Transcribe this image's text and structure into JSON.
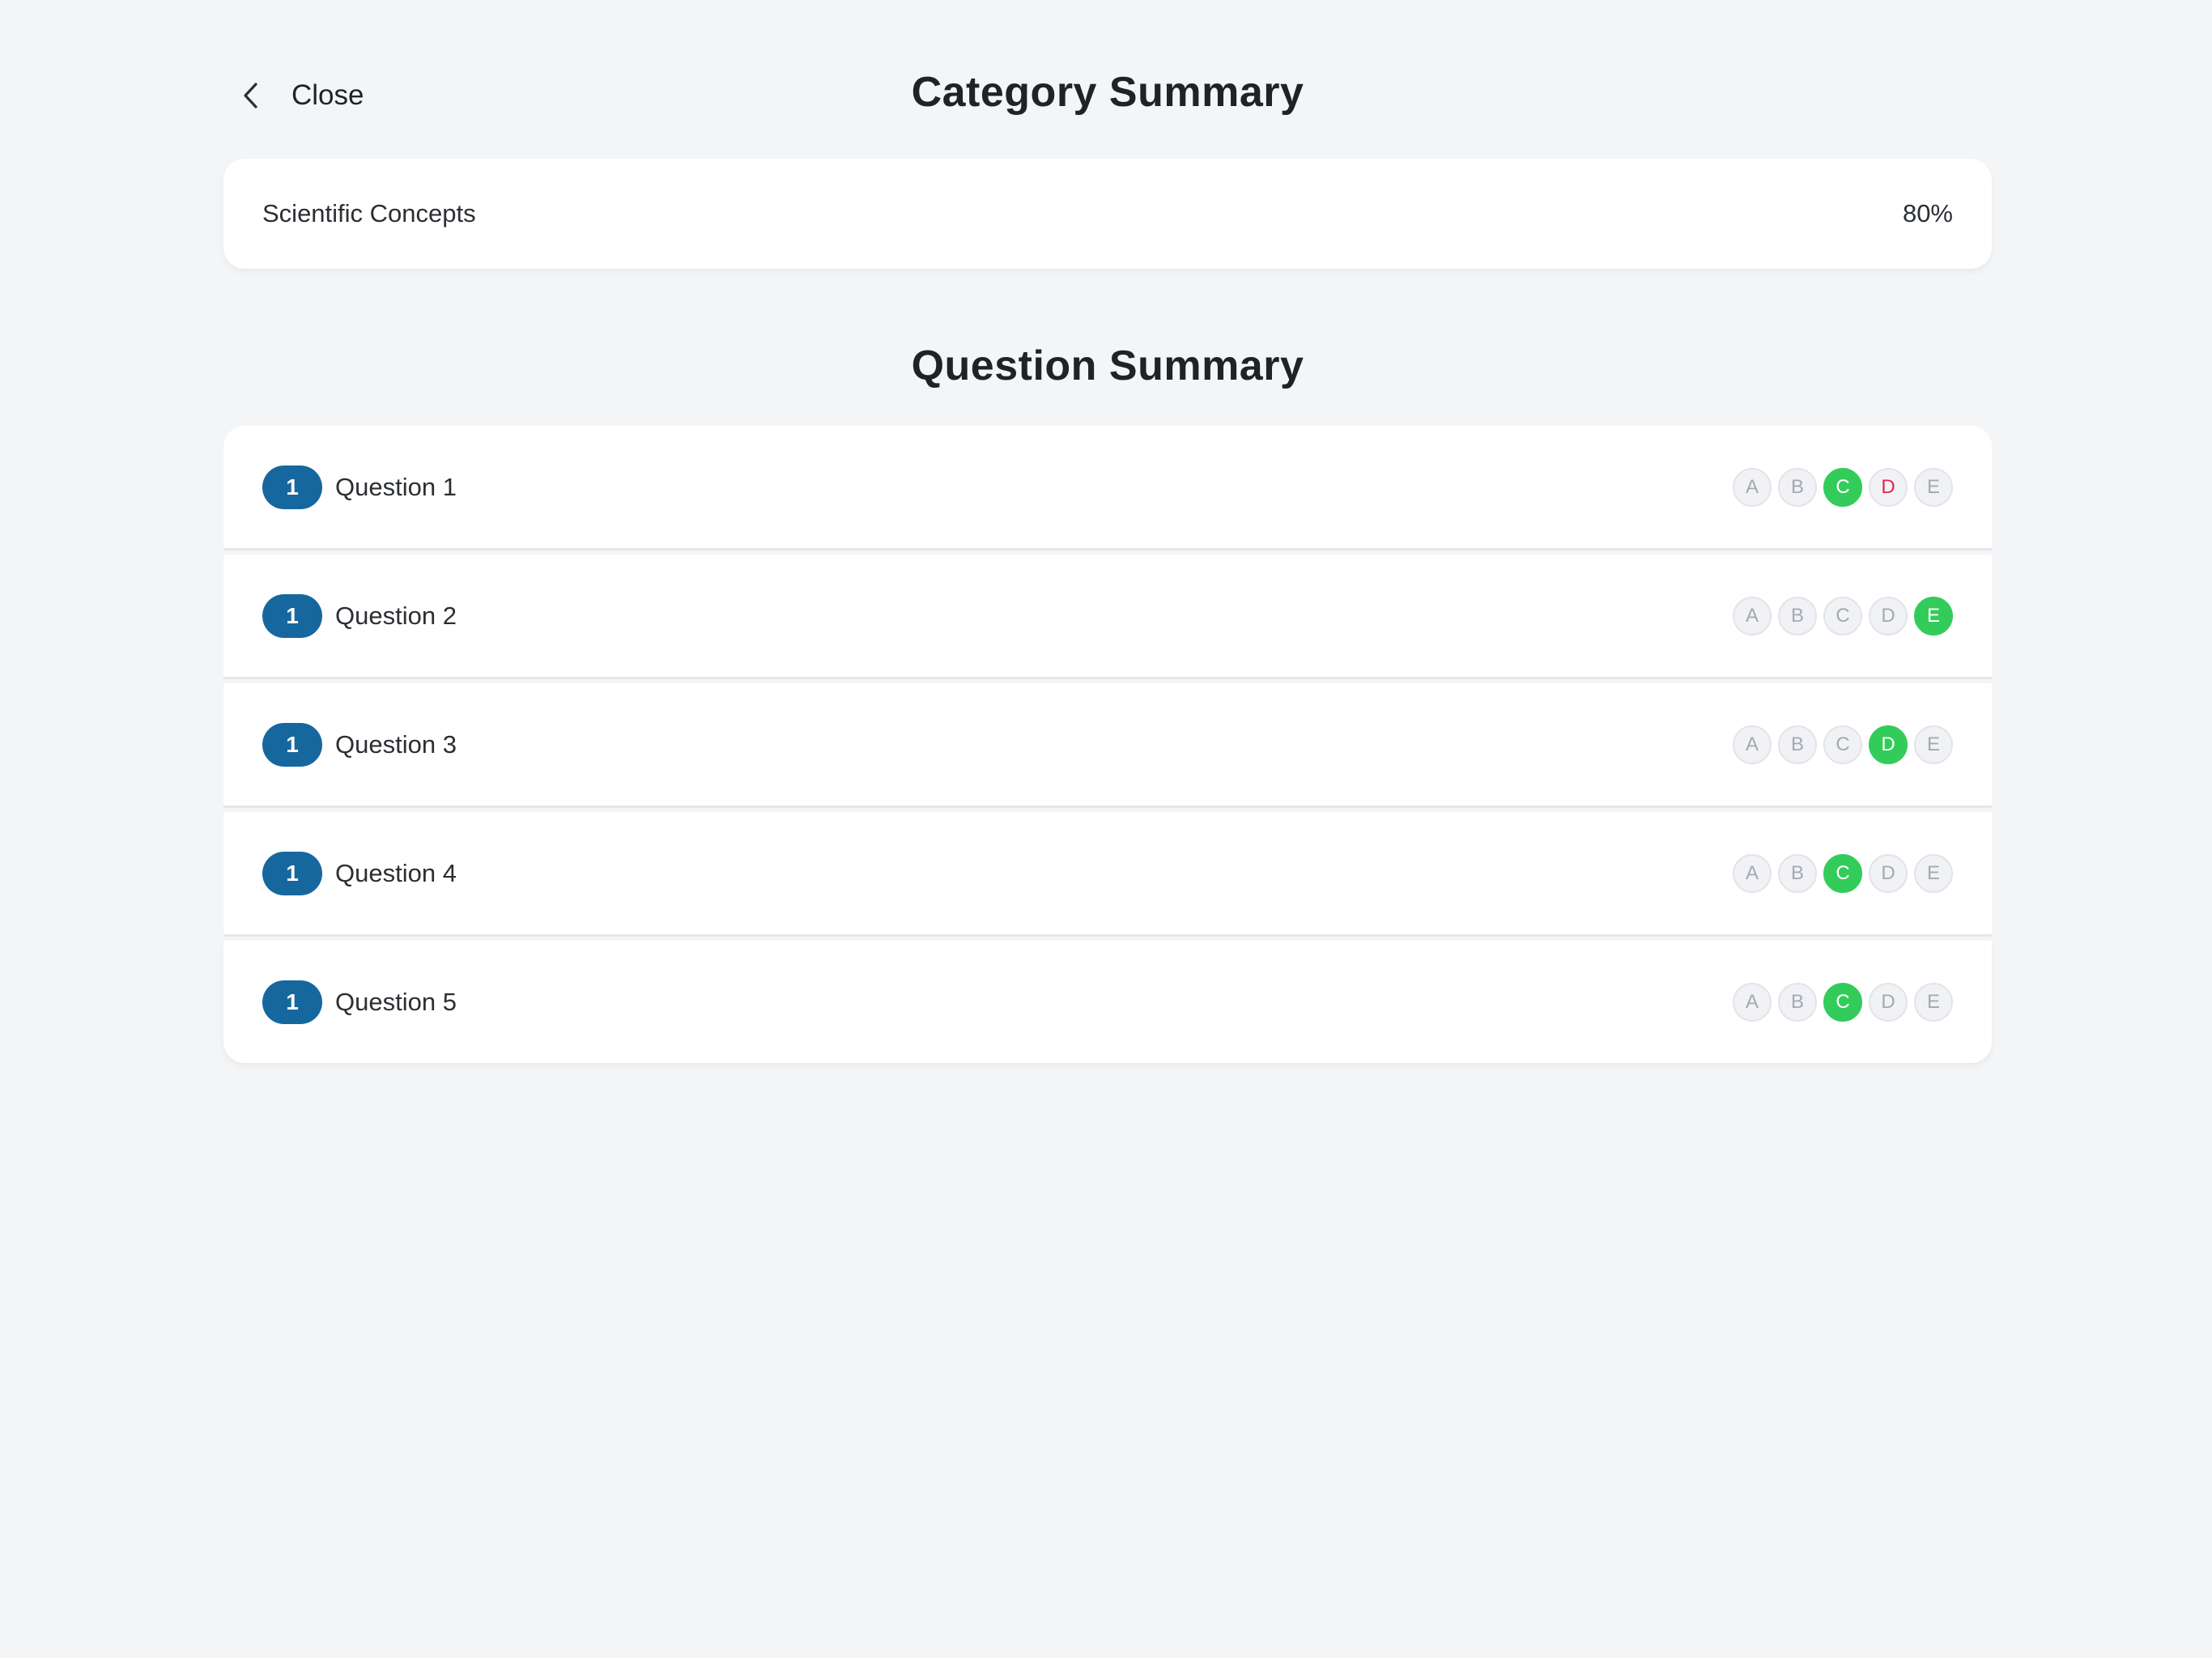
{
  "header": {
    "close_label": "Close",
    "title": "Category Summary"
  },
  "category": {
    "name": "Scientific Concepts",
    "score": "80%"
  },
  "question_summary_title": "Question Summary",
  "questions": [
    {
      "badge": "1",
      "label": "Question 1",
      "options": [
        {
          "letter": "A",
          "state": "neutral"
        },
        {
          "letter": "B",
          "state": "neutral"
        },
        {
          "letter": "C",
          "state": "correct"
        },
        {
          "letter": "D",
          "state": "wrong"
        },
        {
          "letter": "E",
          "state": "neutral"
        }
      ]
    },
    {
      "badge": "1",
      "label": "Question 2",
      "options": [
        {
          "letter": "A",
          "state": "neutral"
        },
        {
          "letter": "B",
          "state": "neutral"
        },
        {
          "letter": "C",
          "state": "neutral"
        },
        {
          "letter": "D",
          "state": "neutral"
        },
        {
          "letter": "E",
          "state": "correct"
        }
      ]
    },
    {
      "badge": "1",
      "label": "Question 3",
      "options": [
        {
          "letter": "A",
          "state": "neutral"
        },
        {
          "letter": "B",
          "state": "neutral"
        },
        {
          "letter": "C",
          "state": "neutral"
        },
        {
          "letter": "D",
          "state": "correct"
        },
        {
          "letter": "E",
          "state": "neutral"
        }
      ]
    },
    {
      "badge": "1",
      "label": "Question 4",
      "options": [
        {
          "letter": "A",
          "state": "neutral"
        },
        {
          "letter": "B",
          "state": "neutral"
        },
        {
          "letter": "C",
          "state": "correct"
        },
        {
          "letter": "D",
          "state": "neutral"
        },
        {
          "letter": "E",
          "state": "neutral"
        }
      ]
    },
    {
      "badge": "1",
      "label": "Question 5",
      "options": [
        {
          "letter": "A",
          "state": "neutral"
        },
        {
          "letter": "B",
          "state": "neutral"
        },
        {
          "letter": "C",
          "state": "correct"
        },
        {
          "letter": "D",
          "state": "neutral"
        },
        {
          "letter": "E",
          "state": "neutral"
        }
      ]
    }
  ],
  "colors": {
    "badge": "#17679f",
    "correct": "#33cc5a",
    "wrong": "#e3264f",
    "background": "#f3f5f7"
  },
  "icons": {
    "close": "chevron-left-icon"
  }
}
